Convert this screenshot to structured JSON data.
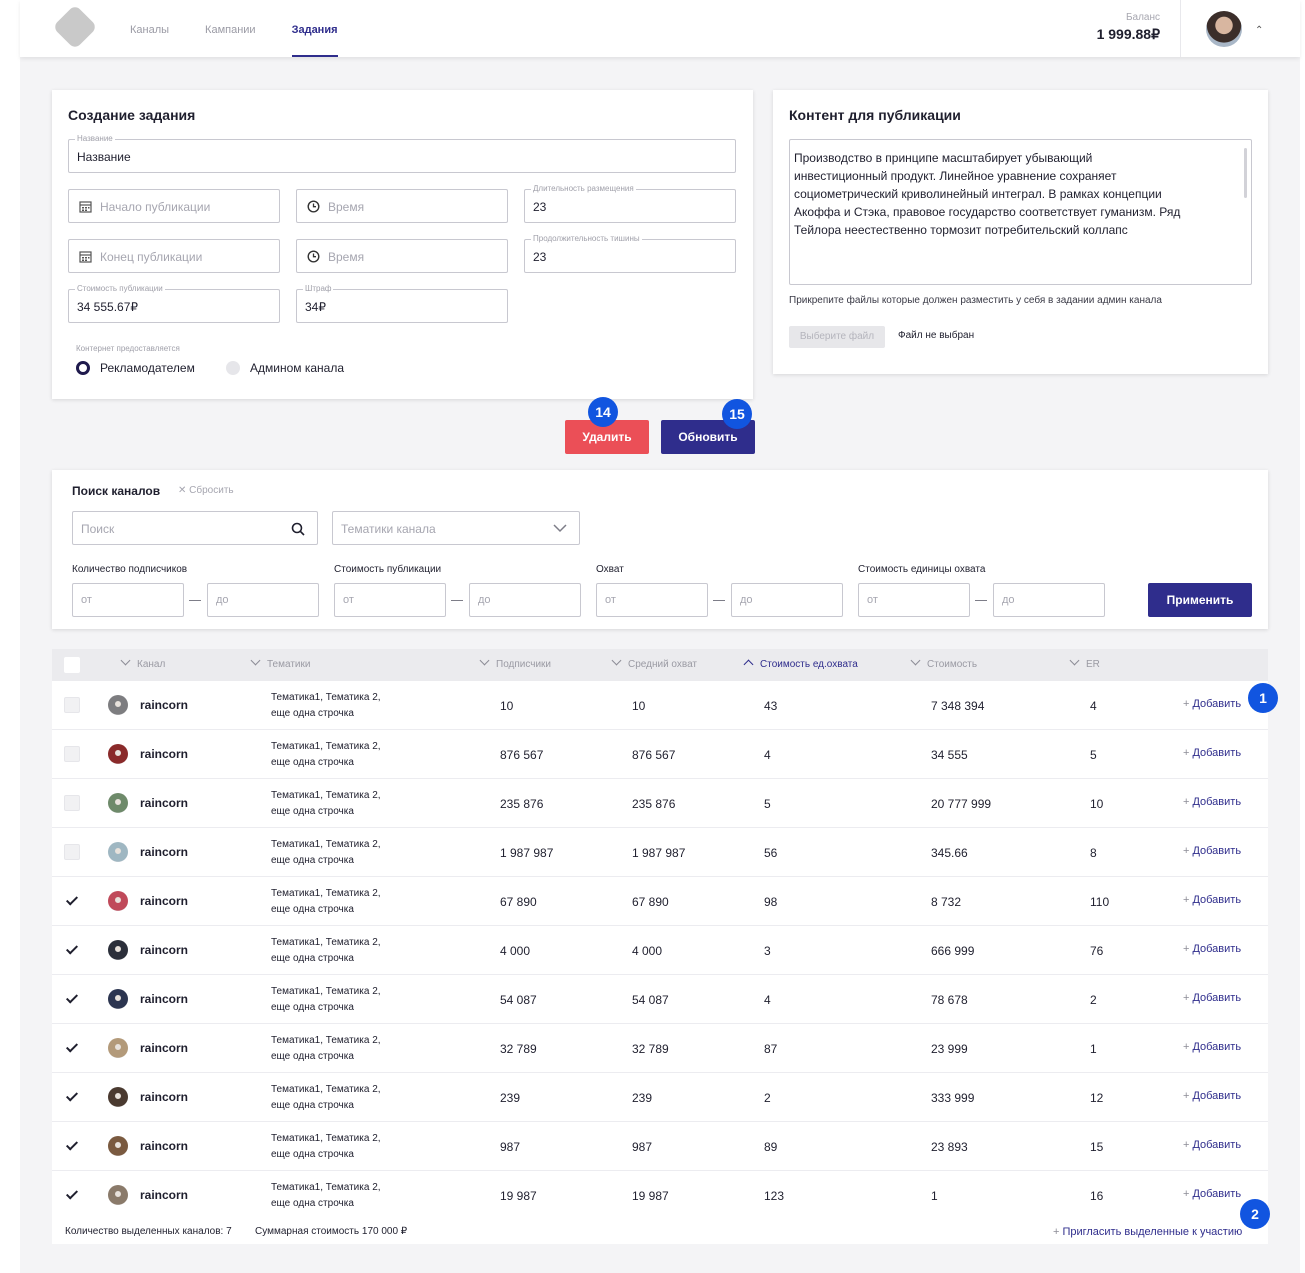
{
  "nav": {
    "items": [
      {
        "label": "Каналы",
        "active": false
      },
      {
        "label": "Кампании",
        "active": false
      },
      {
        "label": "Задания",
        "active": true
      }
    ]
  },
  "balance": {
    "label": "Баланс",
    "value": "1 999.88₽"
  },
  "create_task": {
    "title": "Создание задания",
    "name_label": "Название",
    "name_value": "Название",
    "start_placeholder": "Начало публикации",
    "time_placeholder": "Время",
    "end_placeholder": "Конец публикации",
    "duration_label": "Длительность размещения",
    "duration_value": "23",
    "silence_label": "Продолжительность тишины",
    "silence_value": "23",
    "price_label": "Стоимость публикации",
    "price_value": "34 555.67₽",
    "fine_label": "Штраф",
    "fine_value": "34₽",
    "content_provider_label": "Контернет предоставляется",
    "radio_advertiser": "Рекламодателем",
    "radio_admin": "Админом канала"
  },
  "content": {
    "title": "Контент для публикации",
    "text_lines": [
      "Производство в принципе масштабирует убывающий",
      "инвестиционный продукт. Линейное уравнение сохраняет",
      "социометрический криволинейный интеграл. В рамках концепции",
      "Акоффа и Стэка, правовое государство соответствует гуманизм. Ряд",
      "Тейлора неестественно тормозит потребительский коллапс"
    ],
    "attach_hint": "Прикрепите файлы которые должен разместить у себя в задании админ канала",
    "choose_file": "Выберите файл",
    "no_file": "Файл не выбран"
  },
  "actions": {
    "delete": "Удалить",
    "update": "Обновить",
    "badge_delete": "14",
    "badge_update": "15"
  },
  "search": {
    "title": "Поиск каналов",
    "reset": "Сбросить",
    "search_placeholder": "Поиск",
    "topics_placeholder": "Тематики канала",
    "filters": [
      {
        "label": "Количество подписчиков",
        "from": "от",
        "to": "до"
      },
      {
        "label": "Стоимость публикации",
        "from": "от",
        "to": "до"
      },
      {
        "label": "Охват",
        "from": "от",
        "to": "до"
      },
      {
        "label": "Стоимость единицы охвата",
        "from": "от",
        "to": "до"
      }
    ],
    "apply": "Применить"
  },
  "table": {
    "headers": {
      "channel": "Канал",
      "topics": "Тематики",
      "subscribers": "Подписчики",
      "avg_reach": "Средний охват",
      "unit_cost": "Стоимость ед.охвата",
      "cost": "Стоимость",
      "er": "ER"
    },
    "add_label": "Добавить",
    "topics_line1": "Тематика1, Тематика 2,",
    "topics_line2": "еще одна строчка",
    "rows": [
      {
        "checked": false,
        "name": "raincorn",
        "subs": "10",
        "reach": "10",
        "unit": "43",
        "cost": "7 348 394",
        "er": "4",
        "avatar": "#7d7d80"
      },
      {
        "checked": false,
        "name": "raincorn",
        "subs": "876 567",
        "reach": "876 567",
        "unit": "4",
        "cost": "34 555",
        "er": "5",
        "avatar": "#8a2a2a"
      },
      {
        "checked": false,
        "name": "raincorn",
        "subs": "235 876",
        "reach": "235 876",
        "unit": "5",
        "cost": "20 777 999",
        "er": "10",
        "avatar": "#6e8a6a"
      },
      {
        "checked": false,
        "name": "raincorn",
        "subs": "1 987 987",
        "reach": "1 987 987",
        "unit": "56",
        "cost": "345.66",
        "er": "8",
        "avatar": "#9fb7c2"
      },
      {
        "checked": true,
        "name": "raincorn",
        "subs": "67 890",
        "reach": "67 890",
        "unit": "98",
        "cost": "8 732",
        "er": "110",
        "avatar": "#c04a5a"
      },
      {
        "checked": true,
        "name": "raincorn",
        "subs": "4 000",
        "reach": "4 000",
        "unit": "3",
        "cost": "666 999",
        "er": "76",
        "avatar": "#2b2f3a"
      },
      {
        "checked": true,
        "name": "raincorn",
        "subs": "54 087",
        "reach": "54 087",
        "unit": "4",
        "cost": "78 678",
        "er": "2",
        "avatar": "#2c3550"
      },
      {
        "checked": true,
        "name": "raincorn",
        "subs": "32 789",
        "reach": "32 789",
        "unit": "87",
        "cost": "23 999",
        "er": "1",
        "avatar": "#b39a7a"
      },
      {
        "checked": true,
        "name": "raincorn",
        "subs": "239",
        "reach": "239",
        "unit": "2",
        "cost": "333 999",
        "er": "12",
        "avatar": "#4a3a30"
      },
      {
        "checked": true,
        "name": "raincorn",
        "subs": "987",
        "reach": "987",
        "unit": "89",
        "cost": "23 893",
        "er": "15",
        "avatar": "#7a5a40"
      },
      {
        "checked": true,
        "name": "raincorn",
        "subs": "19 987",
        "reach": "19 987",
        "unit": "123",
        "cost": "1",
        "er": "16",
        "avatar": "#8a7a6a"
      }
    ],
    "badge_add": "1",
    "badge_invite": "2",
    "footer_selected": "Количество выделенных каналов: 7",
    "footer_total": "Суммарная стоимость 170 000 ₽",
    "invite": "Пригласить выделенные к участию"
  }
}
